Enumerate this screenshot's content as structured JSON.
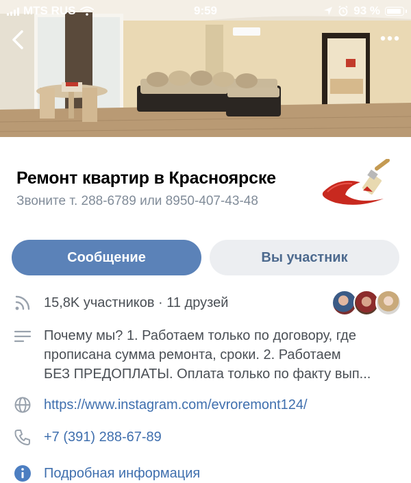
{
  "status_bar": {
    "carrier": "MTS RUS",
    "time": "9:59",
    "battery_percent": "93 %",
    "battery_level": 0.93
  },
  "group": {
    "title": "Ремонт квартир в Красноярске",
    "subtitle": "Звоните т. 288-6789 или 8950-407-43-48"
  },
  "actions": {
    "message_label": "Сообщение",
    "member_label": "Вы участник"
  },
  "members": {
    "text": "15,8K участников · 11 друзей"
  },
  "description": {
    "line1": "Почему мы? 1. Работаем только по договору, где",
    "line2": "прописана сумма ремонта, сроки.  2. Работаем",
    "line3": "БЕЗ ПРЕДОПЛАТЫ. Оплата только по факту вып..."
  },
  "website": {
    "url": "https://www.instagram.com/evroremont124/"
  },
  "phone": {
    "number": "+7 (391) 288-67-89"
  },
  "more_info": {
    "label": "Подробная информация"
  },
  "icons": {
    "back": "chevron-left-icon",
    "more": "ellipsis-icon",
    "members": "rss-icon",
    "description": "lines-icon",
    "website": "globe-icon",
    "phone": "phone-icon",
    "info": "info-icon"
  },
  "colors": {
    "primary_button": "#5b82b8",
    "secondary_button": "#eceef1",
    "link": "#3f6fae",
    "muted_text": "#818c99"
  }
}
